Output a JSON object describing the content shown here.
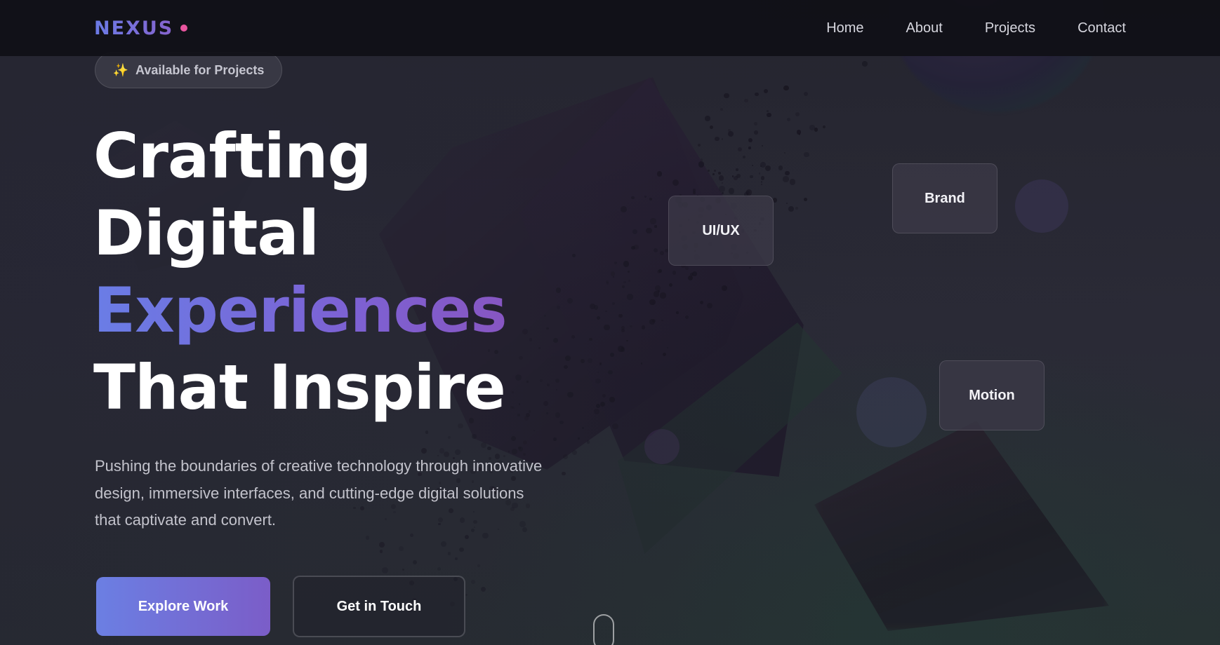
{
  "nav": {
    "logo": "NEXUS",
    "links": [
      "Home",
      "About",
      "Projects",
      "Contact"
    ]
  },
  "hero": {
    "badge": "Available for Projects",
    "badge_icon": "sparkles-icon",
    "headline": [
      "Crafting",
      "Digital",
      "Experiences",
      "That Inspire"
    ],
    "subtitle": "Pushing the boundaries of creative technology through innovative design, immersive interfaces, and cutting-edge digital solutions that captivate and convert.",
    "primary_cta": "Explore Work",
    "secondary_cta": "Get in Touch"
  },
  "tags": [
    "UI/UX",
    "Brand",
    "Motion"
  ],
  "colors": {
    "accent_start": "#6b7fe3",
    "accent_end": "#7b5dc8",
    "logo_dot": "#e9559f",
    "background": "#272733"
  }
}
